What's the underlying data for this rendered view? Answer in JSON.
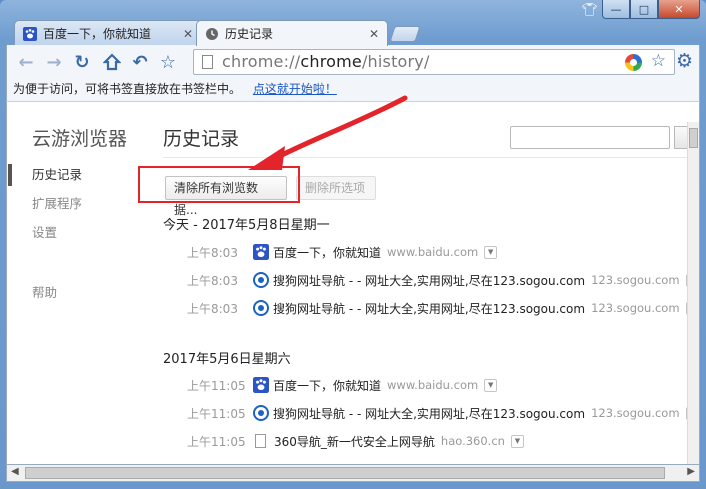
{
  "tabs": [
    {
      "label": "百度一下，你就知道",
      "active": false
    },
    {
      "label": "历史记录",
      "active": true
    }
  ],
  "toolbar": {
    "url_scheme": "chrome://",
    "url_host": "chrome",
    "url_path": "/history/"
  },
  "bookmarks_bar": {
    "prompt": "为便于访问，可将书签直接放在书签栏中。",
    "link": "点这就开始啦！"
  },
  "sidebar": {
    "brand": "云游浏览器",
    "items": [
      {
        "label": "历史记录",
        "selected": true
      },
      {
        "label": "扩展程序",
        "selected": false
      },
      {
        "label": "设置",
        "selected": false
      }
    ],
    "help": "帮助"
  },
  "main": {
    "title": "历史记录",
    "clear_button": "清除所有浏览数据...",
    "remove_button": "删除所选项"
  },
  "days": [
    {
      "heading": "今天 - 2017年5月8日星期一",
      "entries": [
        {
          "time": "上午8:03",
          "title": "百度一下，你就知道",
          "domain": "www.baidu.com",
          "icon": "baidu-paw-icon"
        },
        {
          "time": "上午8:03",
          "title": "搜狗网址导航 - - 网址大全,实用网址,尽在123.sogou.com",
          "domain": "123.sogou.com",
          "icon": "sogou-icon"
        },
        {
          "time": "上午8:03",
          "title": "搜狗网址导航 - - 网址大全,实用网址,尽在123.sogou.com",
          "domain": "123.sogou.com",
          "icon": "sogou-icon"
        }
      ]
    },
    {
      "heading": "2017年5月6日星期六",
      "entries": [
        {
          "time": "上午11:05",
          "title": "百度一下，你就知道",
          "domain": "www.baidu.com",
          "icon": "baidu-paw-icon"
        },
        {
          "time": "上午11:05",
          "title": "搜狗网址导航 - - 网址大全,实用网址,尽在123.sogou.com",
          "domain": "123.sogou.com",
          "icon": "sogou-icon"
        },
        {
          "time": "上午11:05",
          "title": "360导航_新一代安全上网导航",
          "domain": "hao.360.cn",
          "icon": "page-icon"
        }
      ]
    }
  ],
  "annotation": {
    "color": "#e3242b"
  }
}
